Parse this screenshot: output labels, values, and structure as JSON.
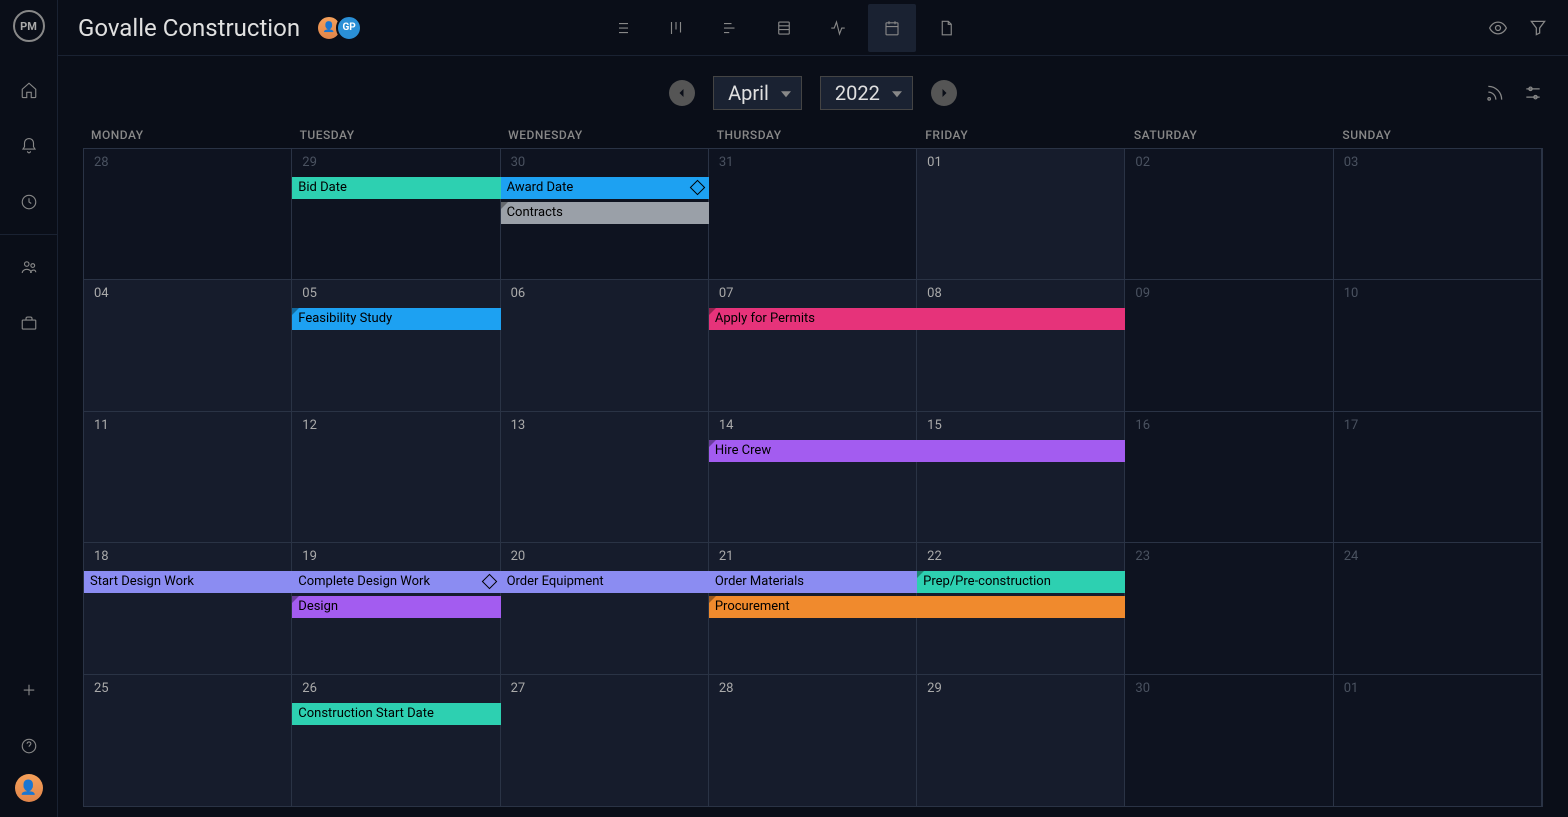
{
  "project": {
    "title": "Govalle Construction"
  },
  "avatars": [
    "👤",
    "GP"
  ],
  "calendar": {
    "month": "April",
    "year": "2022",
    "day_headers": [
      "MONDAY",
      "TUESDAY",
      "WEDNESDAY",
      "THURSDAY",
      "FRIDAY",
      "SATURDAY",
      "SUNDAY"
    ],
    "weeks": [
      {
        "days": [
          {
            "num": "28",
            "outside": true
          },
          {
            "num": "29",
            "outside": true
          },
          {
            "num": "30",
            "outside": true
          },
          {
            "num": "31",
            "outside": true
          },
          {
            "num": "01"
          },
          {
            "num": "02",
            "outside": true
          },
          {
            "num": "03",
            "outside": true
          }
        ],
        "events": [
          {
            "label": "Bid Date",
            "color": "#2dd0b1",
            "start": 1,
            "span": 1,
            "row": 0
          },
          {
            "label": "Award Date",
            "color": "#1da1f2",
            "start": 2,
            "span": 1,
            "row": 0,
            "milestone": true
          },
          {
            "label": "Contracts",
            "color": "#9aa0a8",
            "start": 2,
            "span": 1,
            "row": 1,
            "corner": true
          }
        ]
      },
      {
        "days": [
          {
            "num": "04"
          },
          {
            "num": "05"
          },
          {
            "num": "06"
          },
          {
            "num": "07"
          },
          {
            "num": "08"
          },
          {
            "num": "09",
            "outside": true
          },
          {
            "num": "10",
            "outside": true
          }
        ],
        "events": [
          {
            "label": "Feasibility Study",
            "color": "#1da1f2",
            "start": 1,
            "span": 1,
            "row": 0,
            "corner": true
          },
          {
            "label": "Apply for Permits",
            "color": "#e6337a",
            "start": 3,
            "span": 2,
            "row": 0,
            "corner": true
          }
        ]
      },
      {
        "days": [
          {
            "num": "11"
          },
          {
            "num": "12"
          },
          {
            "num": "13"
          },
          {
            "num": "14"
          },
          {
            "num": "15"
          },
          {
            "num": "16",
            "outside": true
          },
          {
            "num": "17",
            "outside": true
          }
        ],
        "events": [
          {
            "label": "Hire Crew",
            "color": "#a35cf0",
            "start": 3,
            "span": 2,
            "row": 0,
            "corner": true
          }
        ]
      },
      {
        "days": [
          {
            "num": "18"
          },
          {
            "num": "19"
          },
          {
            "num": "20"
          },
          {
            "num": "21"
          },
          {
            "num": "22"
          },
          {
            "num": "23",
            "outside": true
          },
          {
            "num": "24",
            "outside": true
          }
        ],
        "events": [
          {
            "label": "Start Design Work",
            "color": "#8b8cf2",
            "start": 0,
            "span": 1,
            "row": 0
          },
          {
            "label": "Complete Design Work",
            "color": "#8b8cf2",
            "start": 1,
            "span": 1,
            "row": 0,
            "milestone": true
          },
          {
            "label": "Order Equipment",
            "color": "#8b8cf2",
            "start": 2,
            "span": 1,
            "row": 0
          },
          {
            "label": "Order Materials",
            "color": "#8b8cf2",
            "start": 3,
            "span": 1,
            "row": 0
          },
          {
            "label": "Prep/Pre-construction",
            "color": "#2dd0b1",
            "start": 4,
            "span": 1,
            "row": 0,
            "corner": true
          },
          {
            "label": "Design",
            "color": "#a35cf0",
            "start": 1,
            "span": 1,
            "row": 1,
            "corner": true
          },
          {
            "label": "Procurement",
            "color": "#f08a2d",
            "start": 3,
            "span": 2,
            "row": 1,
            "corner": true
          }
        ]
      },
      {
        "days": [
          {
            "num": "25"
          },
          {
            "num": "26"
          },
          {
            "num": "27"
          },
          {
            "num": "28"
          },
          {
            "num": "29"
          },
          {
            "num": "30",
            "outside": true
          },
          {
            "num": "01",
            "outside": true
          }
        ],
        "events": [
          {
            "label": "Construction Start Date",
            "color": "#2dd0b1",
            "start": 1,
            "span": 1,
            "row": 0
          }
        ]
      }
    ]
  }
}
